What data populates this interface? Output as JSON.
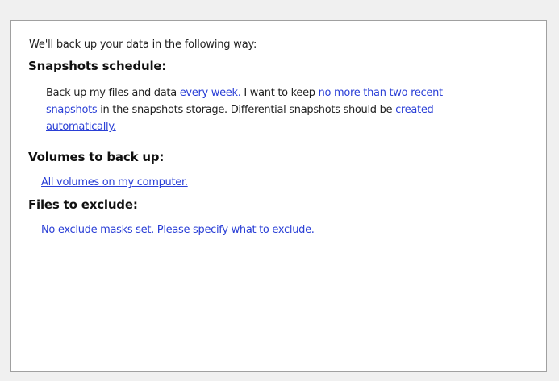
{
  "summary": {
    "intro": "We'll back up your data in the following way:",
    "schedule": {
      "heading": "Snapshots schedule:",
      "text_1": "Back up my files and data ",
      "link_frequency": "every week.",
      "text_2": " I want to keep ",
      "link_retention_part1": "no more than two recent",
      "link_retention_part2": "snapshots",
      "text_3": " in the snapshots storage. Differential snapshots should be ",
      "link_differential_part1": "created",
      "link_differential_part2": "automatically."
    },
    "volumes": {
      "heading": "Volumes to back up:",
      "link": "All volumes on my computer."
    },
    "exclude": {
      "heading": "Files to exclude:",
      "link": "No exclude masks set. Please specify what to exclude."
    }
  },
  "colors": {
    "link": "#2a3fd6",
    "text": "#222222",
    "panel_border": "#a0a0a0",
    "background": "#f0f0f0"
  }
}
